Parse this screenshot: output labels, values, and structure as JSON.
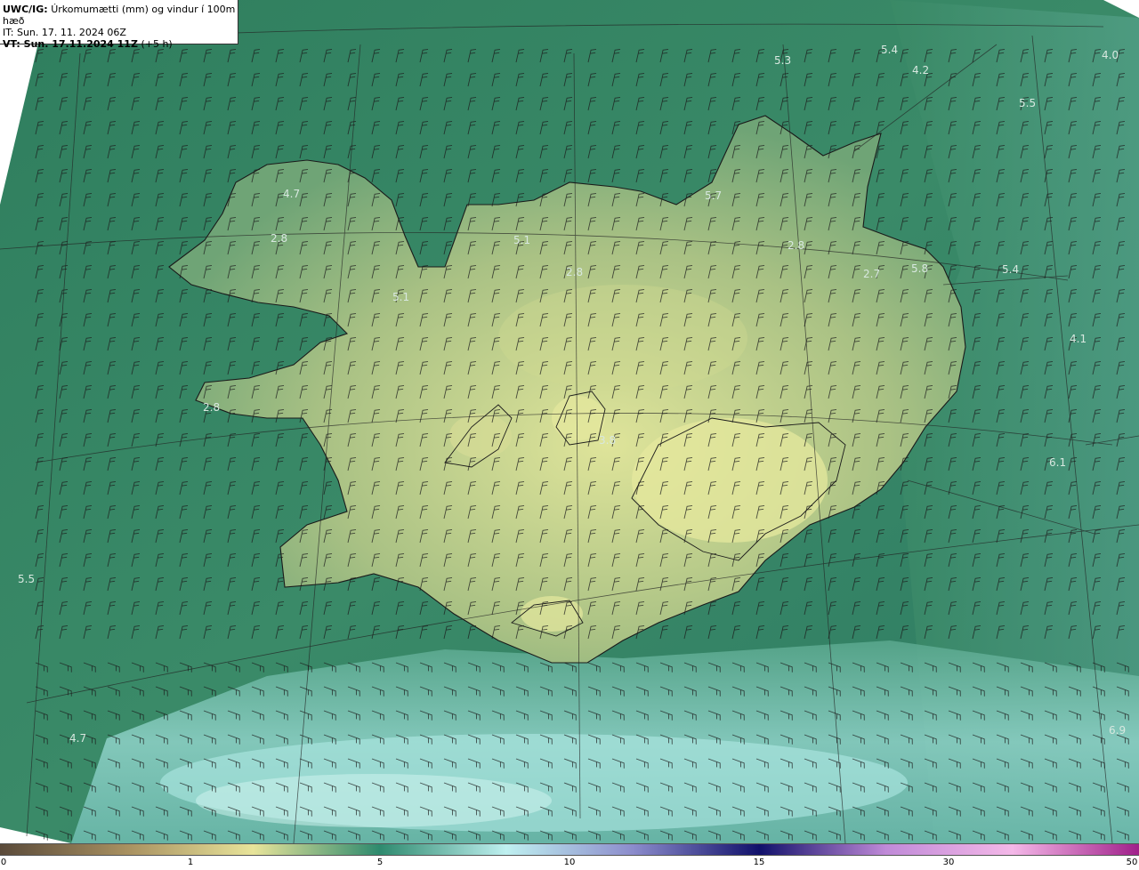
{
  "header": {
    "product": "UWC/IG:",
    "description": "Úrkomumætti (mm) og vindur í 100m hæð",
    "initial_time": "IT: Sun. 17. 11. 2024 06Z",
    "valid_prefix": "VT: Sun. 17.11.2024 11Z",
    "valid_offset": "(+5 h)"
  },
  "colorbar": {
    "ticks": [
      "0",
      "1",
      "5",
      "10",
      "15",
      "30",
      "50"
    ],
    "colors": [
      "#5a4a3a",
      "#a89060",
      "#e8e49a",
      "#2e8a6e",
      "#bff0f0",
      "#8c8ccc",
      "#10106a",
      "#c08ad8",
      "#f4b8e8",
      "#a0208a"
    ]
  },
  "map": {
    "sea_color": "#2f8a6a",
    "land_color": "#b8c78a",
    "highland_color": "#dde69a",
    "value_labels": [
      {
        "text": "5.3"
      },
      {
        "text": "5.4"
      },
      {
        "text": "4.2"
      },
      {
        "text": "4.0"
      },
      {
        "text": "5.5"
      },
      {
        "text": "4.7"
      },
      {
        "text": "2.8"
      },
      {
        "text": "5.7"
      },
      {
        "text": "5.1"
      },
      {
        "text": "2.8"
      },
      {
        "text": "2.8"
      },
      {
        "text": "2.7"
      },
      {
        "text": "5.8"
      },
      {
        "text": "5.4"
      },
      {
        "text": "5.1"
      },
      {
        "text": "4.1"
      },
      {
        "text": "2.8"
      },
      {
        "text": "3.8"
      },
      {
        "text": "6.1"
      },
      {
        "text": "5.5"
      },
      {
        "text": "4.7"
      },
      {
        "text": "6.9"
      }
    ]
  }
}
